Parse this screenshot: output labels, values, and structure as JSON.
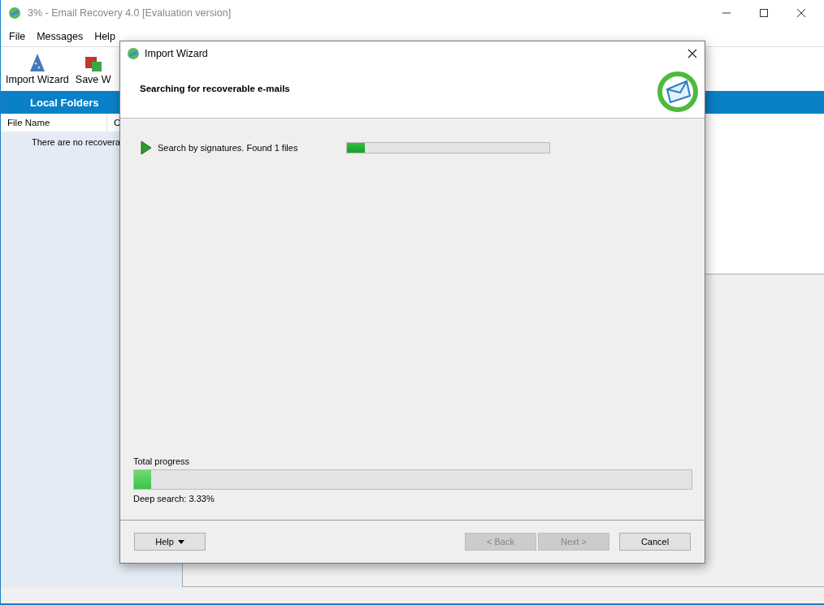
{
  "window": {
    "title": "3% - Email Recovery 4.0 [Evaluation version]"
  },
  "menu": [
    "File",
    "Messages",
    "Help"
  ],
  "toolbar": [
    {
      "label": "Import Wizard",
      "kind": "wizard"
    },
    {
      "label": "Save W",
      "kind": "save"
    }
  ],
  "sidebar": {
    "header": "Local Folders",
    "columns": [
      "File Name",
      "C"
    ],
    "empty_message": "There are no recovera"
  },
  "dialog": {
    "title": "Import Wizard",
    "heading": "Searching for recoverable e-mails",
    "task": {
      "label": "Search by signatures. Found 1 files",
      "level": 0.09
    },
    "total": {
      "label": "Total progress",
      "level": 0.03,
      "status": "Deep search:  3.33%"
    },
    "buttons": [
      {
        "label": "Help",
        "kind": "menu",
        "disabled": false
      },
      {
        "label": "< Back",
        "kind": "plain",
        "disabled": true
      },
      {
        "label": "Next >",
        "kind": "plain",
        "disabled": true
      },
      {
        "label": "Cancel",
        "kind": "plain",
        "disabled": false
      }
    ]
  }
}
